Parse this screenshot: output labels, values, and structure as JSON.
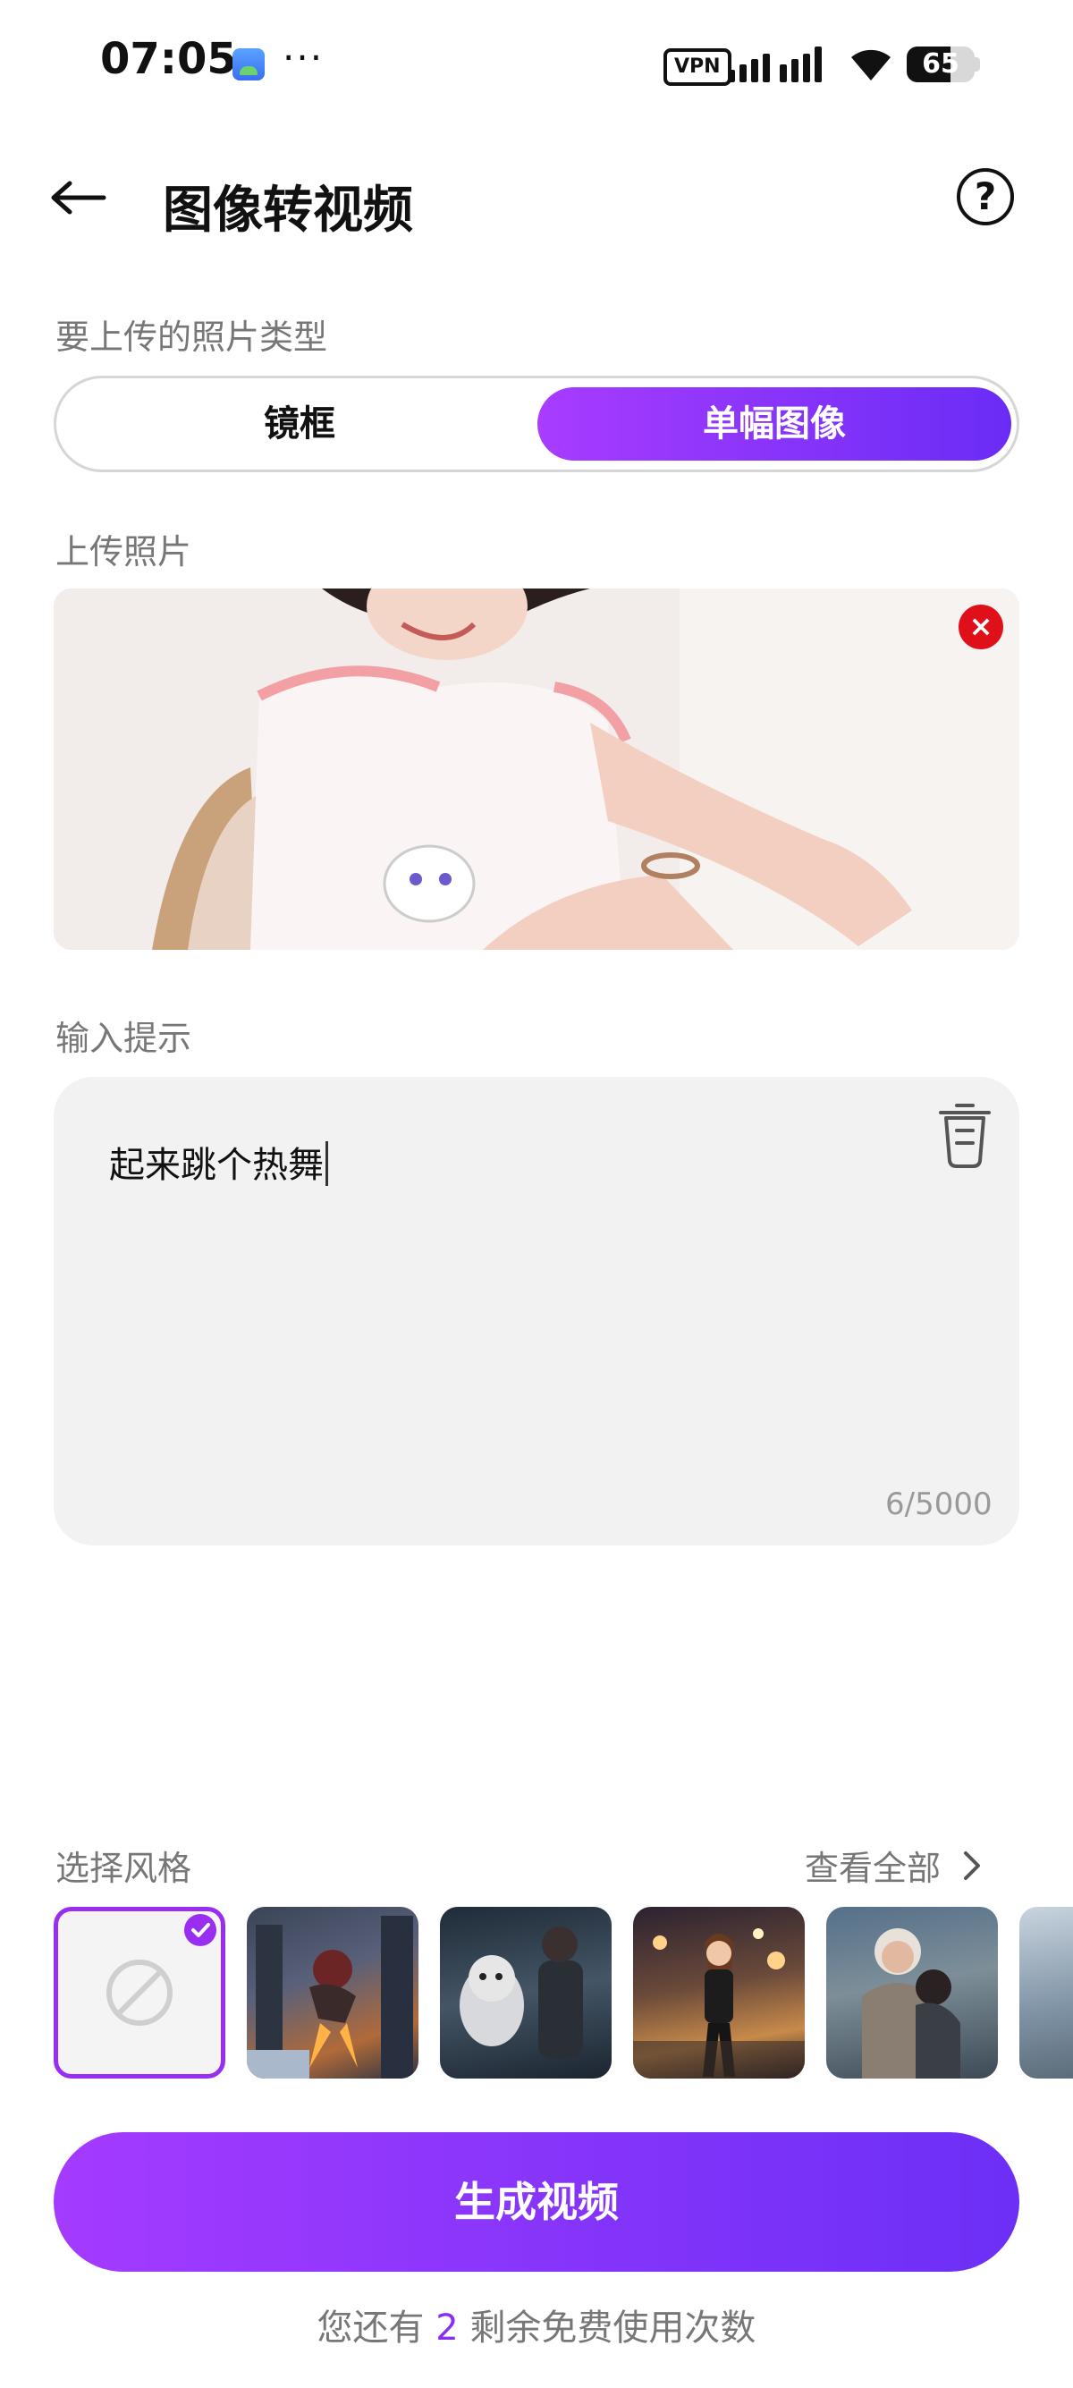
{
  "status_bar": {
    "time": "07:05",
    "more": "···",
    "vpn": "VPN",
    "battery": "65"
  },
  "header": {
    "title": "图像转视频",
    "help": "?"
  },
  "photo_type": {
    "label": "要上传的照片类型",
    "options": [
      "镜框",
      "单幅图像"
    ],
    "selected": "单幅图像"
  },
  "upload": {
    "label": "上传照片",
    "remove": "×"
  },
  "prompt": {
    "label": "输入提示",
    "value": "起来跳个热舞",
    "count": "6/5000"
  },
  "styles": {
    "label": "选择风格",
    "view_all": "查看全部",
    "selected_index": 0
  },
  "generate": {
    "button": "生成视频",
    "quota_prefix": "您还有",
    "quota_count": "2",
    "quota_suffix": "剩余免费使用次数"
  },
  "colors": {
    "accent_start": "#a43bff",
    "accent_end": "#6c2ff6",
    "remove": "#e0101a"
  }
}
